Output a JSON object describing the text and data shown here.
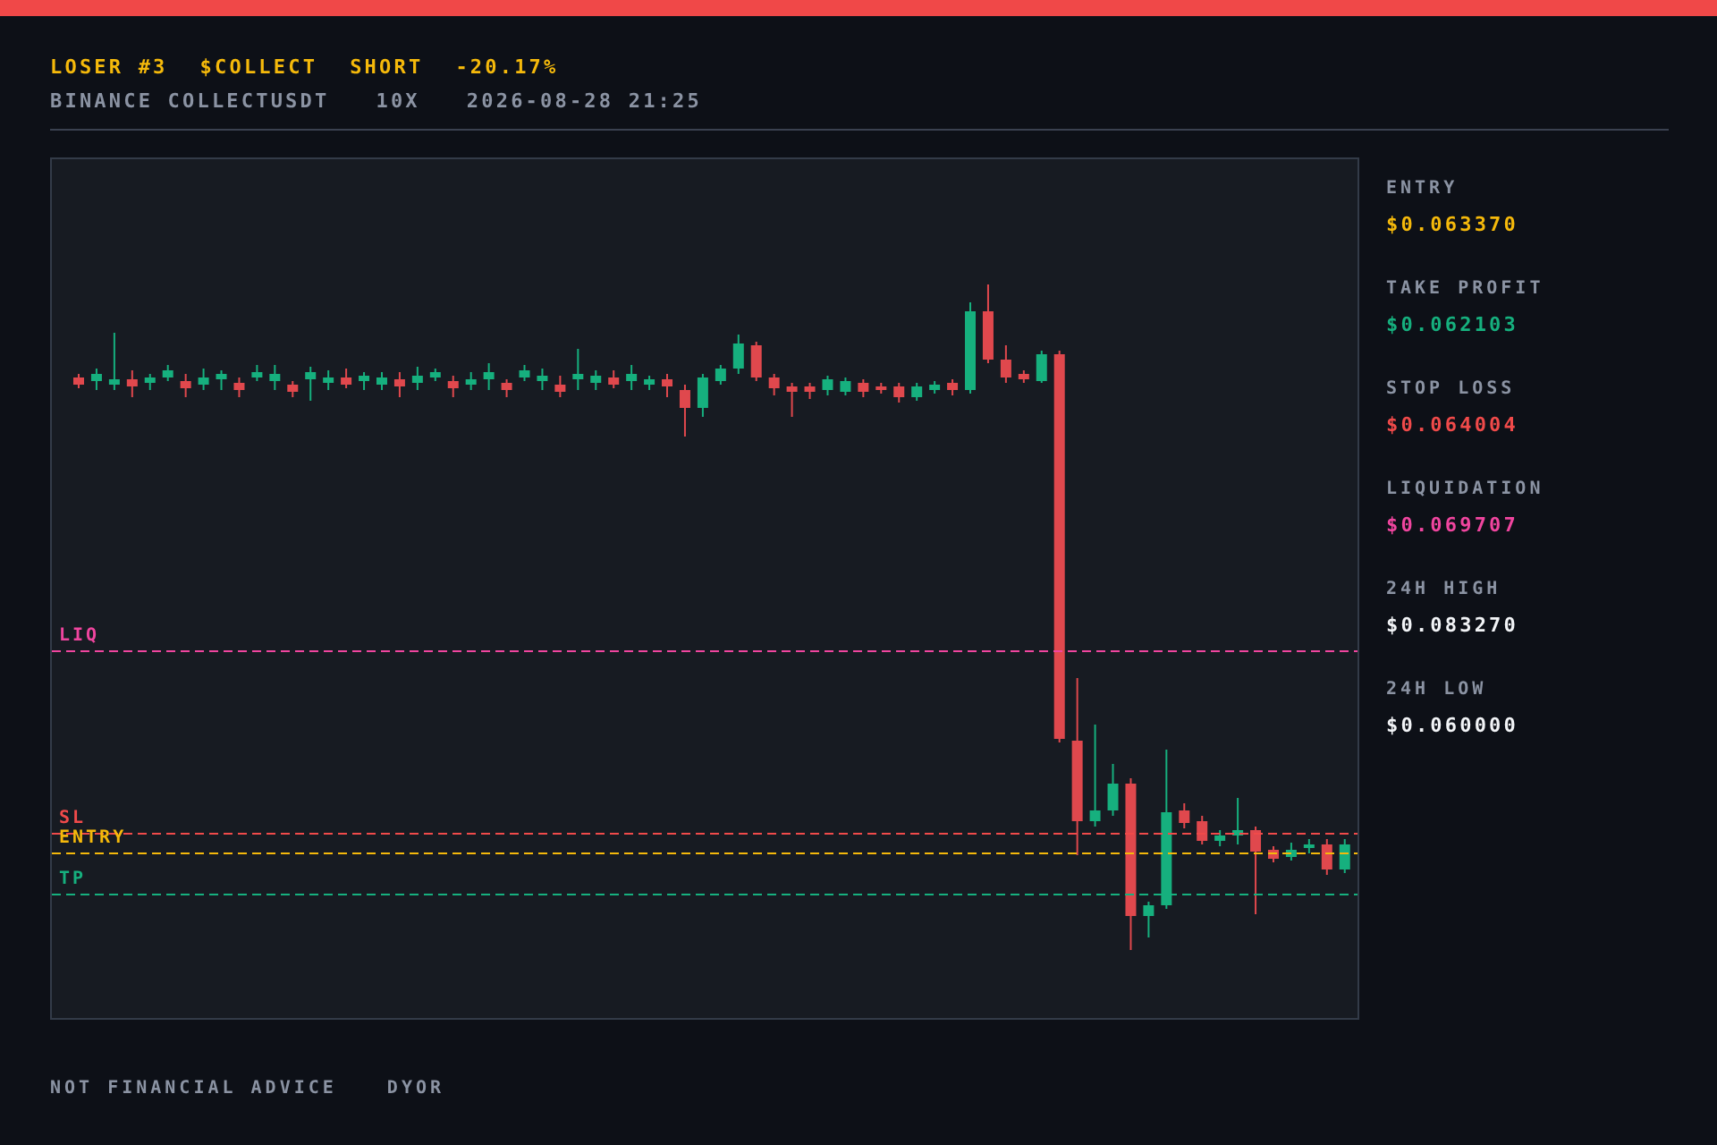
{
  "header": {
    "title_parts": [
      "LOSER #3",
      "$COLLECT",
      "SHORT",
      "-20.17%"
    ],
    "subtitle_parts": [
      "BINANCE COLLECTUSDT",
      "10X",
      "2026-08-28 21:25"
    ]
  },
  "chart": {
    "levels": [
      {
        "label": "LIQ",
        "color": "#f0459f"
      },
      {
        "label": "SL",
        "color": "#f04a4a"
      },
      {
        "label": "ENTRY",
        "color": "#f5b90b"
      },
      {
        "label": "TP",
        "color": "#16b07e"
      }
    ]
  },
  "stats": [
    {
      "label": "ENTRY",
      "value": "$0.063370",
      "color": "#f5b90b"
    },
    {
      "label": "TAKE PROFIT",
      "value": "$0.062103",
      "color": "#16b07e"
    },
    {
      "label": "STOP LOSS",
      "value": "$0.064004",
      "color": "#f04a4a"
    },
    {
      "label": "LIQUIDATION",
      "value": "$0.069707",
      "color": "#f0459f"
    },
    {
      "label": "24H HIGH",
      "value": "$0.083270",
      "color": "#f2f4f7"
    },
    {
      "label": "24H LOW",
      "value": "$0.060000",
      "color": "#f2f4f7"
    }
  ],
  "footer": [
    "NOT FINANCIAL ADVICE",
    "DYOR"
  ]
}
